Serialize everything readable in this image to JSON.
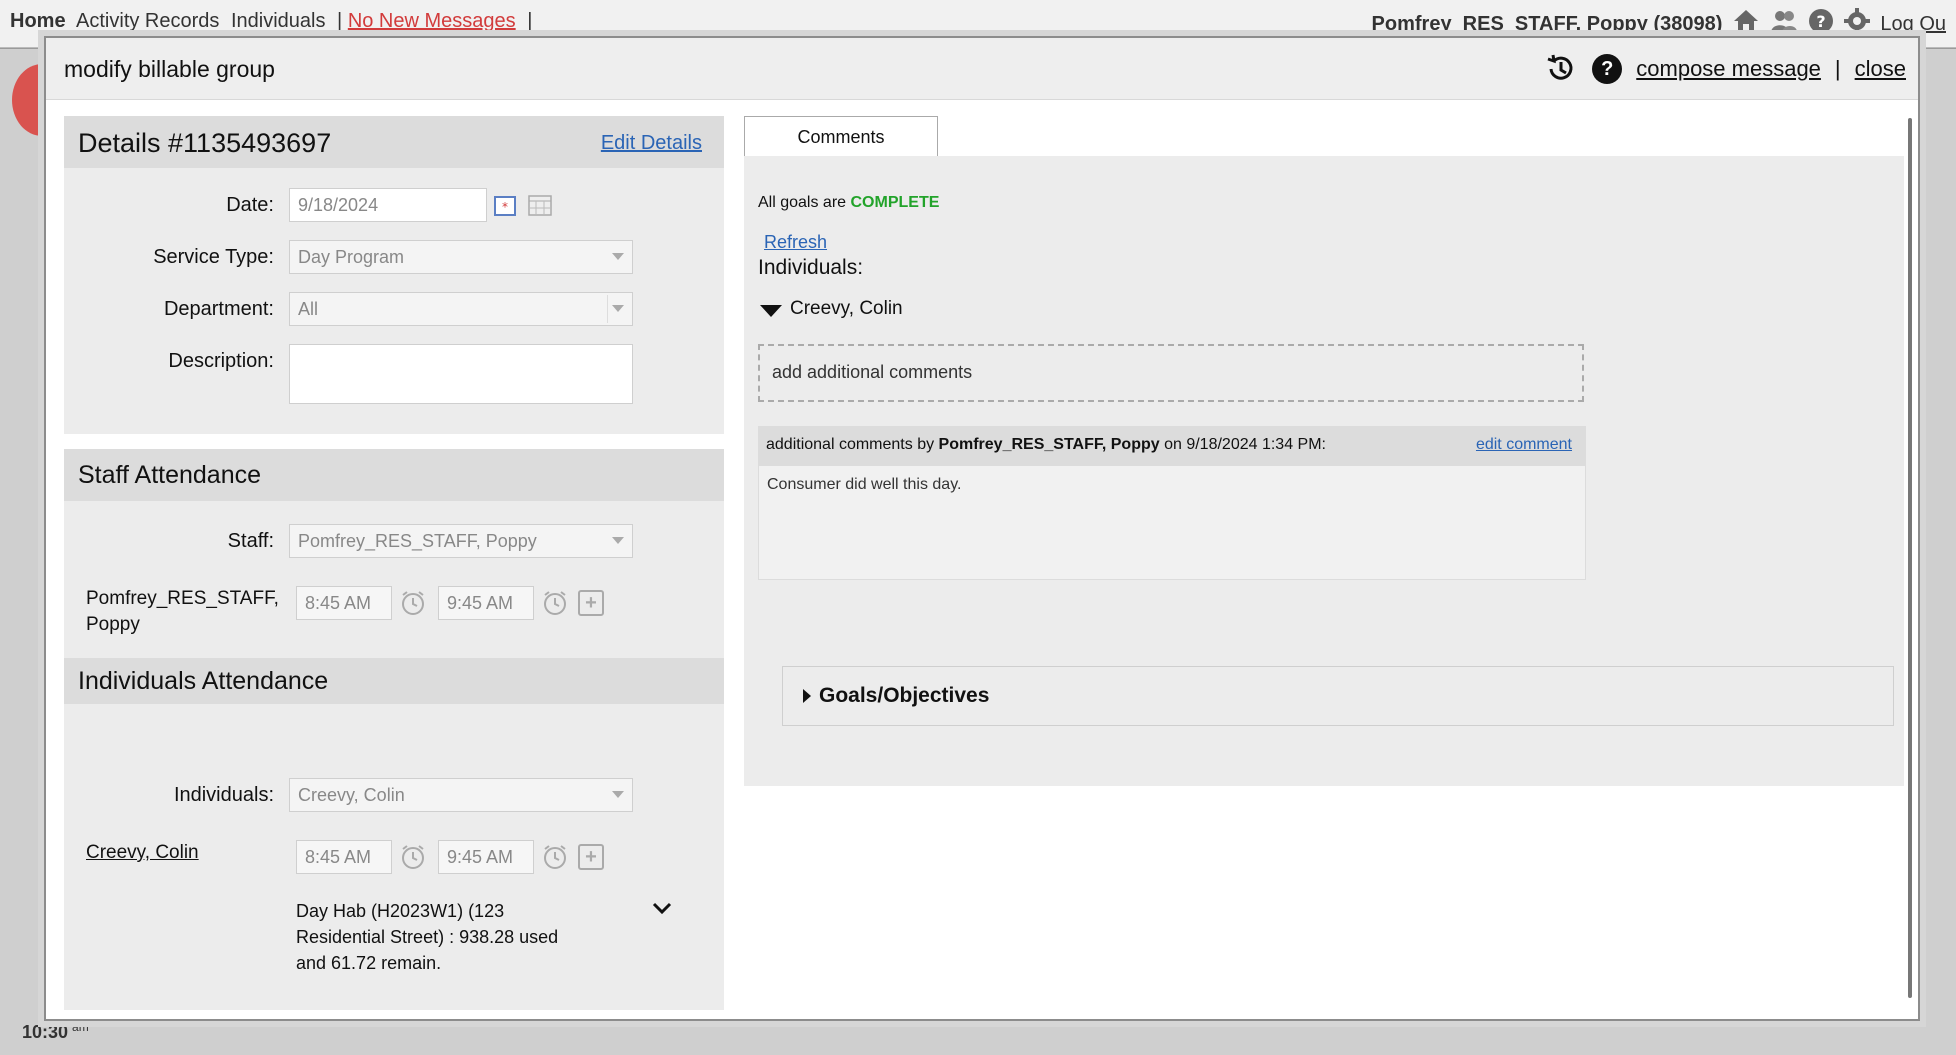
{
  "bg": {
    "nav": {
      "home": "Home",
      "activity_records": "Activity Records",
      "individuals": "Individuals",
      "sep": "|",
      "messages": "No New Messages"
    },
    "user": "Pomfrey_RES_STAFF, Poppy (38098)",
    "logout": "Log Ou",
    "time": "10:30",
    "time_suffix": "am"
  },
  "modal": {
    "title": "modify billable group",
    "compose": "compose message",
    "sep": "|",
    "close": "close"
  },
  "details": {
    "title": "Details #1135493697",
    "edit": "Edit Details",
    "date_label": "Date:",
    "date_value": "9/18/2024",
    "service_type_label": "Service Type:",
    "service_type_value": "Day Program",
    "department_label": "Department:",
    "department_value": "All",
    "description_label": "Description:",
    "description_value": ""
  },
  "staff_attendance": {
    "title": "Staff Attendance",
    "staff_label": "Staff:",
    "staff_value": "Pomfrey_RES_STAFF, Poppy",
    "person_line1": "Pomfrey_RES_STAFF,",
    "person_line2": "Poppy",
    "start": "8:45 AM",
    "end": "9:45 AM"
  },
  "individuals_attendance": {
    "title": "Individuals Attendance",
    "individuals_label": "Individuals:",
    "individuals_value": "Creevy, Colin",
    "person": "Creevy, Colin",
    "start": "8:45 AM",
    "end": "9:45 AM",
    "auth_line1": "Day Hab (H2023W1) (123",
    "auth_line2": "Residential Street) : 938.28 used",
    "auth_line3": "and 61.72 remain."
  },
  "comments": {
    "tab": "Comments",
    "goals_prefix": "All goals are",
    "goals_status": "COMPLETE",
    "refresh": "Refresh",
    "individuals_label": "Individuals:",
    "individual": "Creevy, Colin",
    "add_placeholder": "add additional comments",
    "comment_prefix": "additional comments by",
    "comment_author": "Pomfrey_RES_STAFF, Poppy",
    "comment_on": "on 9/18/2024 1:34 PM:",
    "edit_comment": "edit comment",
    "comment_text": "Consumer did well this day.",
    "goals_objectives": "Goals/Objectives"
  },
  "colors": {
    "link": "#2a64b5",
    "complete": "#22a32a",
    "messages": "#d23b3b"
  }
}
